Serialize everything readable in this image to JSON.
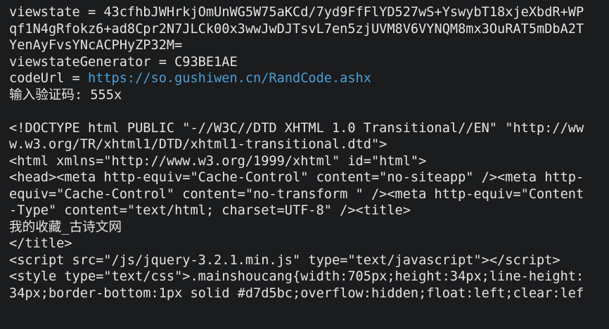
{
  "colors": {
    "background": "#1b1c1e",
    "text": "#e4e4e4",
    "link": "#4b9fd6"
  },
  "output": {
    "viewstate": [
      "viewstate = 43cfhbJWHrkjOmUnWG5W75aKCd/7yd9FfFlYD527wS+YswybT18xjeXbdR+WP",
      "qf1N4gRfokz6+ad8Cpr2N7JLCk00x3wwJwDJTsvL7en5zjUVM8V6VYNQM8mx3OuRAT5mDbA2T",
      "YenAyFvsYNcACPHyZP32M="
    ],
    "viewstate_generator": "viewstateGenerator = C93BE1AE",
    "code_url_label": "codeUrl = ",
    "code_url": "https://so.gushiwen.cn/RandCode.ashx",
    "captcha_prompt": "输入验证码: 555x",
    "html_lines": [
      "<!DOCTYPE html PUBLIC \"-//W3C//DTD XHTML 1.0 Transitional//EN\" \"http://ww",
      "w.w3.org/TR/xhtml1/DTD/xhtml1-transitional.dtd\">",
      "<html xmlns=\"http://www.w3.org/1999/xhtml\" id=\"html\">",
      "<head><meta http-equiv=\"Cache-Control\" content=\"no-siteapp\" /><meta http-",
      "equiv=\"Cache-Control\" content=\"no-transform \" /><meta http-equiv=\"Content",
      "-Type\" content=\"text/html; charset=UTF-8\" /><title>",
      "我的收藏_古诗文网",
      "</title>",
      "<script src=\"/js/jquery-3.2.1.min.js\" type=\"text/javascript\"></script>",
      "<style type=\"text/css\">.mainshoucang{width:705px;height:34px;line-height:",
      "34px;border-bottom:1px solid #d7d5bc;overflow:hidden;float:left;clear:lef"
    ]
  }
}
